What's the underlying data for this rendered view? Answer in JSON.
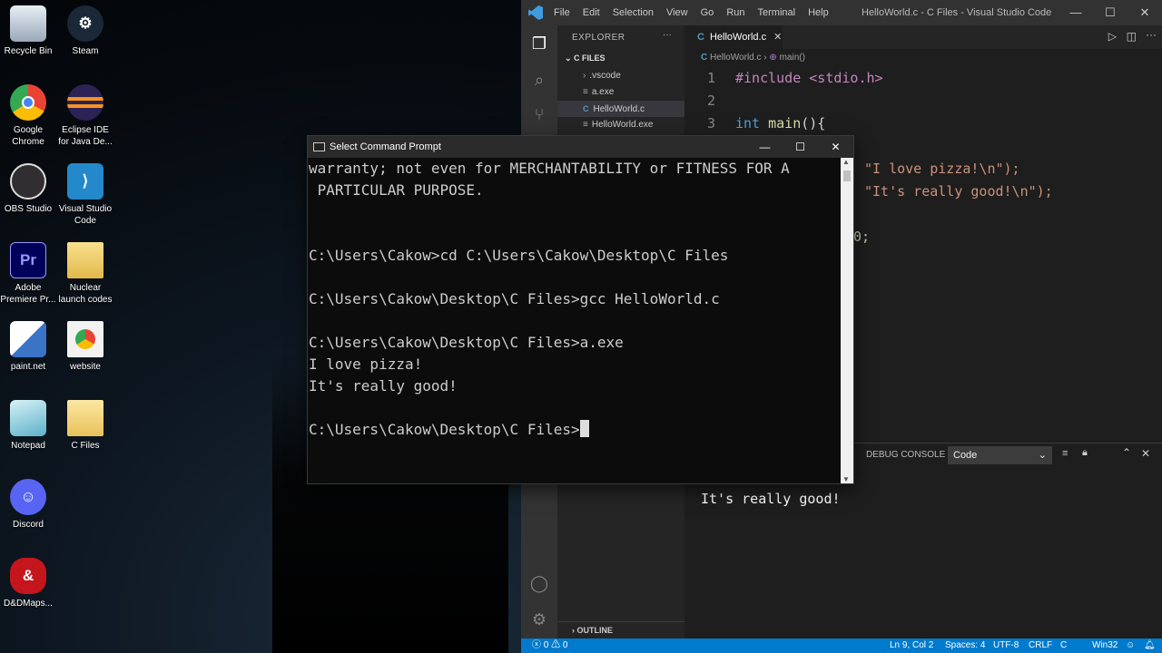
{
  "desktop": {
    "icons": [
      {
        "label": "Recycle Bin"
      },
      {
        "label": "Steam"
      },
      {
        "label": "Google Chrome"
      },
      {
        "label": "Eclipse IDE for Java De..."
      },
      {
        "label": "OBS Studio"
      },
      {
        "label": "Visual Studio Code"
      },
      {
        "label": "Adobe Premiere Pr..."
      },
      {
        "label": "Nuclear launch codes"
      },
      {
        "label": "paint.net"
      },
      {
        "label": "website"
      },
      {
        "label": "Notepad"
      },
      {
        "label": "C Files"
      },
      {
        "label": "Discord"
      },
      {
        "label": "D&DMaps..."
      }
    ]
  },
  "vscode": {
    "window_title": "HelloWorld.c - C Files - Visual Studio Code",
    "menu": [
      "File",
      "Edit",
      "Selection",
      "View",
      "Go",
      "Run",
      "Terminal",
      "Help"
    ],
    "explorer_title": "EXPLORER",
    "folder": "C FILES",
    "files": [
      ".vscode",
      "a.exe",
      "HelloWorld.c",
      "HelloWorld.exe"
    ],
    "outline": "OUTLINE",
    "tab": "HelloWorld.c",
    "breadcrumb_file": "HelloWorld.c",
    "breadcrumb_symbol": "main()",
    "code": {
      "l1": "#include <stdio.h>",
      "l3_type": "int",
      "l3_fn": "main",
      "l3_rest": "(){",
      "l4_str": "\"I love pizza!\\n\");",
      "l5_str": "\"It's really good!\\n\");",
      "l6_num": "0;"
    },
    "line_numbers": [
      "1",
      "2",
      "3"
    ],
    "panel": {
      "tab": "DEBUG CONSOLE",
      "dropdown": "Code",
      "output": "It's really good!"
    },
    "status": {
      "errors": "0",
      "warnings": "0",
      "position": "Ln 9, Col 2",
      "spaces": "Spaces: 4",
      "encoding": "UTF-8",
      "eol": "CRLF",
      "lang": "C",
      "platform": "Win32"
    }
  },
  "cmd": {
    "title": "Select Command Prompt",
    "lines": [
      "warranty; not even for MERCHANTABILITY or FITNESS FOR A",
      " PARTICULAR PURPOSE.",
      "",
      "",
      "C:\\Users\\Cakow>cd C:\\Users\\Cakow\\Desktop\\C Files",
      "",
      "C:\\Users\\Cakow\\Desktop\\C Files>gcc HelloWorld.c",
      "",
      "C:\\Users\\Cakow\\Desktop\\C Files>a.exe",
      "I love pizza!",
      "It's really good!",
      "",
      "C:\\Users\\Cakow\\Desktop\\C Files>"
    ]
  }
}
